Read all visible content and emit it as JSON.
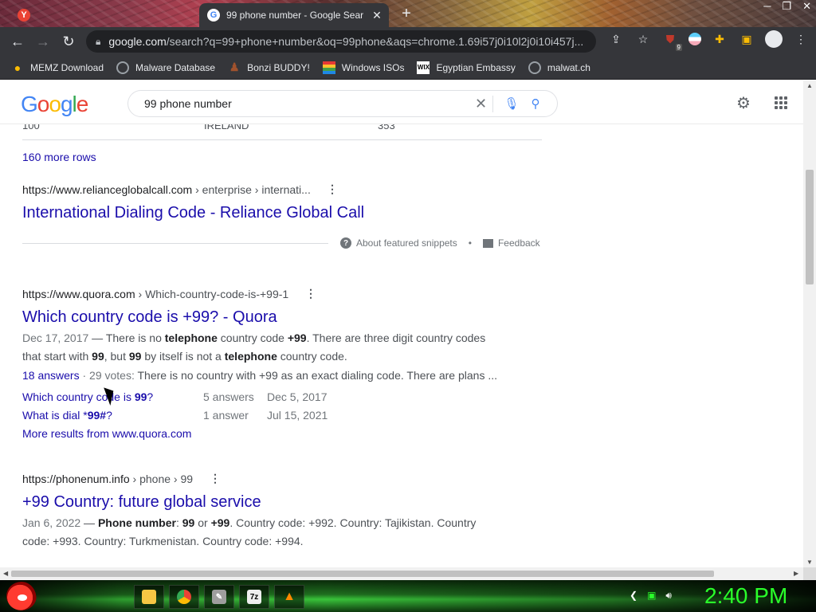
{
  "browser": {
    "tabs": [
      {
        "title": "",
        "active": false
      },
      {
        "title": "99 phone number - Google Sear",
        "active": true
      }
    ],
    "url_domain": "google.com",
    "url_rest": "/search?q=99+phone+number&oq=99phone&aqs=chrome.1.69i57j0i10l2j0i10i457j...",
    "extension_badge": "9",
    "bookmarks": [
      {
        "label": "MEMZ Download",
        "icon": "memz-icon"
      },
      {
        "label": "Malware Database",
        "icon": "globe-icon"
      },
      {
        "label": "Bonzi BUDDY!",
        "icon": "bonzi-icon"
      },
      {
        "label": "Windows ISOs",
        "icon": "windows-icon"
      },
      {
        "label": "Egyptian Embassy",
        "icon": "wix-icon"
      },
      {
        "label": "malwat.ch",
        "icon": "globe-icon"
      }
    ]
  },
  "google": {
    "logo": [
      "G",
      "o",
      "o",
      "g",
      "l",
      "e"
    ],
    "query": "99 phone number"
  },
  "results": {
    "partial_row": [
      "100",
      "IRELAND",
      "353"
    ],
    "more_rows": "160 more rows",
    "reliance": {
      "cite_domain": "https://www.relianceglobalcall.com",
      "cite_path": " › enterprise › internati...",
      "title": "International Dialing Code - Reliance Global Call"
    },
    "about_snippets": "About featured snippets",
    "separator": "•",
    "feedback": "Feedback",
    "quora": {
      "cite_domain": "https://www.quora.com",
      "cite_path": " › Which-country-code-is-+99-1",
      "title": "Which country code is +99? - Quora",
      "date": "Dec 17, 2017",
      "dash": " — ",
      "s1": "There is no ",
      "b1": "telephone",
      "s2": " country code ",
      "b2": "+99",
      "s3": ". There are three digit country codes that start with ",
      "b3": "99",
      "s4": ", but ",
      "b4": "99",
      "s5": " by itself is not a ",
      "b5": "telephone",
      "s6": " country code.",
      "answers_count": "18 answers",
      "votes": " · 29 votes: ",
      "answer_text": "There is no country with +99 as an exact dialing code. There are plans ...",
      "sub_results": [
        {
          "q_prefix": "Which country code is ",
          "q_bold": "99",
          "q_suffix": "?",
          "answers": "5 answers",
          "date": "Dec 5, 2017"
        },
        {
          "q_prefix": "What is dial *",
          "q_bold": "99#",
          "q_suffix": "?",
          "answers": "1 answer",
          "date": "Jul 15, 2021"
        }
      ],
      "more_results": "More results from www.quora.com"
    },
    "phonenum": {
      "cite_domain": "https://phonenum.info",
      "cite_path": " › phone › 99",
      "title": "+99 Country: future global service",
      "date": "Jan 6, 2022",
      "dash": " — ",
      "b1": "Phone number",
      "s1": ": ",
      "b2": "99",
      "s2": " or ",
      "b3": "+99",
      "s3": ". Country code: +992. Country: Tajikistan. Country code: +993. Country: Turkmenistan. Country code: +994."
    }
  },
  "taskbar": {
    "apps": [
      "folder-icon",
      "chrome-icon",
      "paint-icon",
      "7zip-icon",
      "vlc-icon"
    ],
    "clock": "2:40 PM"
  }
}
